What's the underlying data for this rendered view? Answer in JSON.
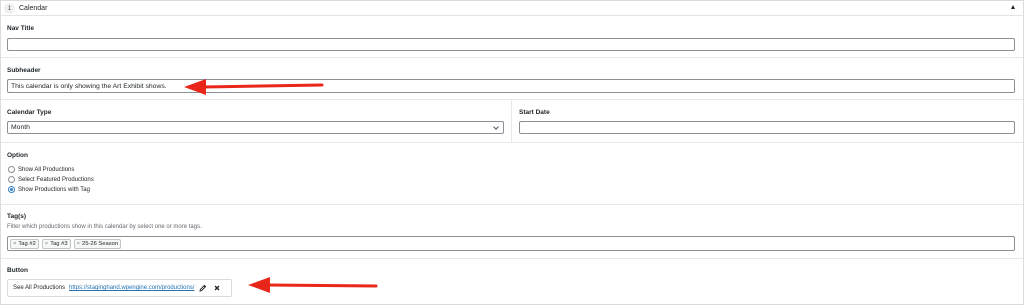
{
  "header": {
    "row_number": "1",
    "title": "Calendar"
  },
  "nav_title": {
    "label": "Nav Title",
    "value": ""
  },
  "subheader": {
    "label": "Subheader",
    "value": "This calendar is only showing the Art Exhibit shows."
  },
  "calendar_type": {
    "label": "Calendar Type",
    "selected": "Month"
  },
  "start_date": {
    "label": "Start Date",
    "value": ""
  },
  "option": {
    "label": "Option",
    "choices": [
      "Show All Productions",
      "Select Featured Productions",
      "Show Productions with Tag"
    ],
    "selected_index": 2
  },
  "tags": {
    "label": "Tag(s)",
    "description": "Filter which productions show in this calendar by select one or more tags.",
    "items": [
      "Tag #2",
      "Tag #3",
      "25-26 Season"
    ],
    "remove_glyph": "×"
  },
  "button": {
    "label": "Button",
    "link_title": "See All Productions",
    "link_url": "https://staginghand.wpengine.com/productions/"
  },
  "colors": {
    "annotation_arrow": "#e8261a",
    "link": "#2271b1",
    "radio_accent": "#3582c4"
  },
  "icons": [
    "chevron-up-icon",
    "chevron-down-icon",
    "pencil-icon",
    "close-icon"
  ]
}
